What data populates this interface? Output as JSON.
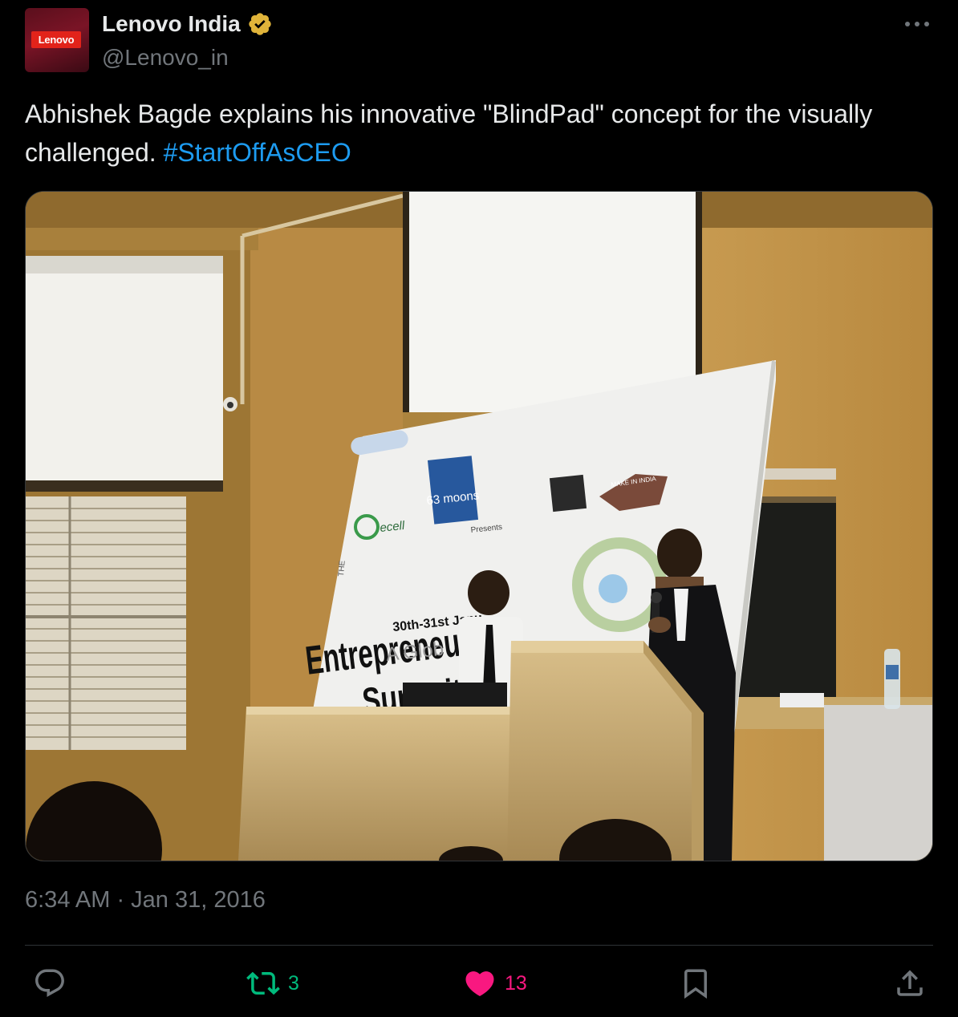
{
  "account": {
    "avatar_logo_text": "Lenovo",
    "display_name": "Lenovo India",
    "handle": "@Lenovo_in",
    "verified_icon": "verified-badge-icon",
    "verified_color": "#e0b43a"
  },
  "tweet": {
    "text": "Abhishek Bagde explains his innovative \"BlindPad\" concept for the visually challenged. ",
    "hashtag": "#StartOffAsCEO",
    "timestamp": "6:34 AM · Jan 31, 2016"
  },
  "media": {
    "banner_logo_1": "63 moons",
    "banner_title": "Entrepreneurship",
    "banner_subtitle": "Summit 2016",
    "banner_dates": "30th-31st Janu",
    "banner_partial": "A Glob",
    "banner_presents": "Presents",
    "banner_the": "THE",
    "banner_ecell": "ecell",
    "banner_make_in_india": "MAKE IN INDIA"
  },
  "actions": {
    "reply_icon": "reply-icon",
    "retweet_icon": "retweet-icon",
    "retweet_count": "3",
    "like_icon": "heart-icon",
    "like_count": "13",
    "bookmark_icon": "bookmark-icon",
    "share_icon": "share-icon"
  },
  "colors": {
    "background": "#000000",
    "text": "#e7e9ea",
    "secondary": "#71767b",
    "link": "#1d9bf0",
    "retweet": "#00ba7c",
    "like": "#f91880"
  }
}
